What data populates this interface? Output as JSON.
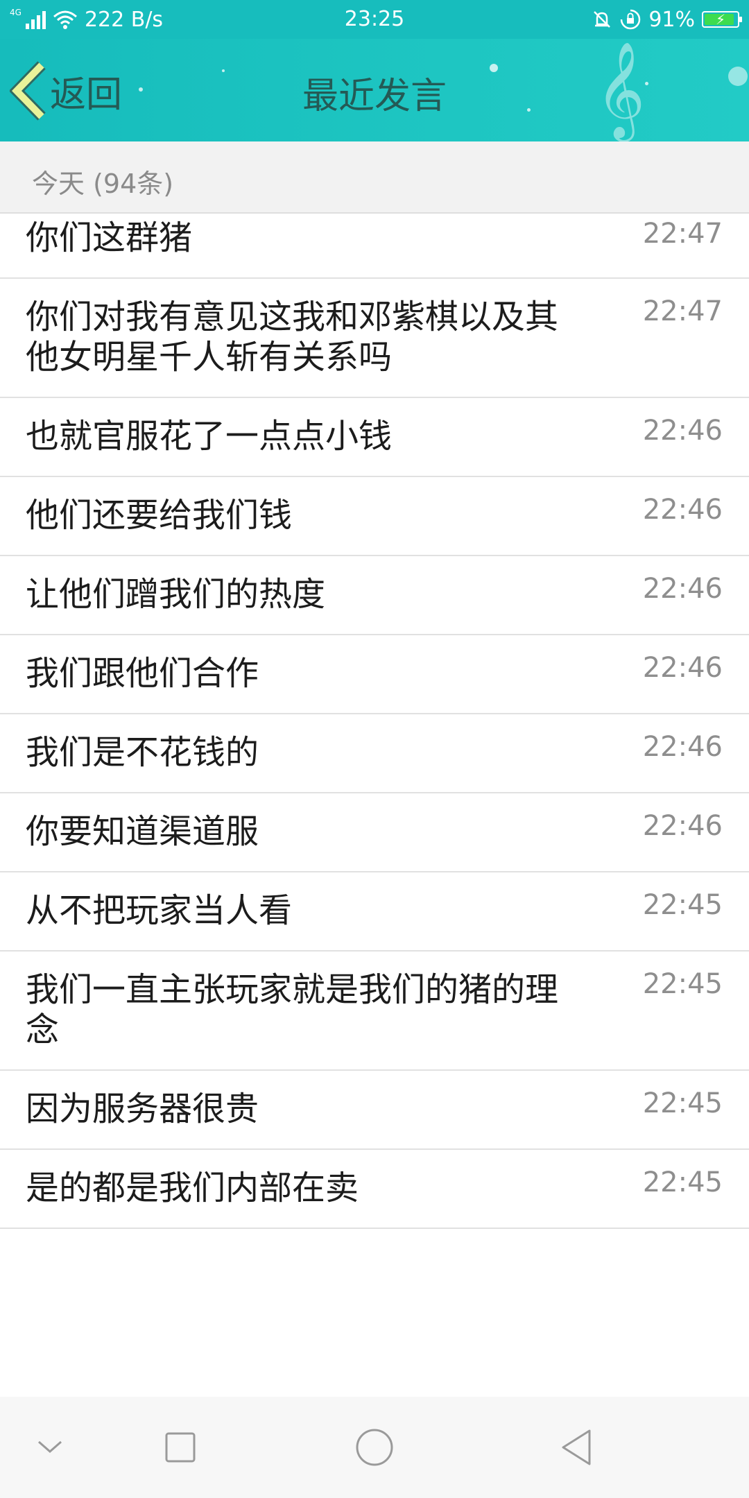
{
  "status_bar": {
    "network_type": "4G",
    "speed": "222 B/s",
    "time": "23:25",
    "battery_percent": "91%",
    "battery_level": 0.91,
    "icons": [
      "signal-icon",
      "wifi-icon",
      "vibrate-icon",
      "rotation-lock-icon",
      "battery-icon"
    ]
  },
  "header": {
    "back_label": "返回",
    "title": "最近发言"
  },
  "section": {
    "label": "今天 (94条)"
  },
  "messages": [
    {
      "text": "你们这群猪",
      "time": "22:47"
    },
    {
      "text": "你们对我有意见这我和邓紫棋以及其他女明星千人斩有关系吗",
      "time": "22:47"
    },
    {
      "text": "也就官服花了一点点小钱",
      "time": "22:46"
    },
    {
      "text": "他们还要给我们钱",
      "time": "22:46"
    },
    {
      "text": "让他们蹭我们的热度",
      "time": "22:46"
    },
    {
      "text": "我们跟他们合作",
      "time": "22:46"
    },
    {
      "text": "我们是不花钱的",
      "time": "22:46"
    },
    {
      "text": "你要知道渠道服",
      "time": "22:46"
    },
    {
      "text": "从不把玩家当人看",
      "time": "22:45"
    },
    {
      "text": "我们一直主张玩家就是我们的猪的理念",
      "time": "22:45"
    },
    {
      "text": "因为服务器很贵",
      "time": "22:45"
    },
    {
      "text": "是的都是我们内部在卖",
      "time": "22:45"
    }
  ],
  "colors": {
    "header_bg": "#17bdbd",
    "title_text": "#245a55",
    "back_chevron": "#e8f39a"
  },
  "nav": {
    "icons": [
      "collapse-icon",
      "recents-icon",
      "home-icon",
      "back-icon"
    ]
  }
}
